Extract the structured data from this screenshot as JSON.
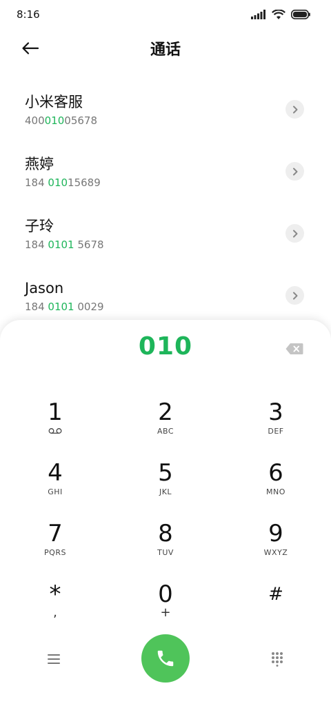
{
  "status_bar": {
    "time": "8:16"
  },
  "header": {
    "title": "通话"
  },
  "contacts": [
    {
      "name": "小米客服",
      "number_pre": "400",
      "number_hl": "010",
      "number_post": "05678"
    },
    {
      "name": "燕婷",
      "number_pre": "184 ",
      "number_hl": "010",
      "number_post": "15689"
    },
    {
      "name": "子玲",
      "number_pre": "184 ",
      "number_hl": "0101",
      "number_post": " 5678"
    },
    {
      "name": "Jason",
      "number_pre": "184 ",
      "number_hl": "0101",
      "number_post": " 0029"
    }
  ],
  "dialer": {
    "input": "010",
    "keys": [
      {
        "digit": "1",
        "letters": ""
      },
      {
        "digit": "2",
        "letters": "ABC"
      },
      {
        "digit": "3",
        "letters": "DEF"
      },
      {
        "digit": "4",
        "letters": "GHI"
      },
      {
        "digit": "5",
        "letters": "JKL"
      },
      {
        "digit": "6",
        "letters": "MNO"
      },
      {
        "digit": "7",
        "letters": "PQRS"
      },
      {
        "digit": "8",
        "letters": "TUV"
      },
      {
        "digit": "9",
        "letters": "WXYZ"
      },
      {
        "digit": "*",
        "letters": ","
      },
      {
        "digit": "0",
        "letters": "+"
      },
      {
        "digit": "#",
        "letters": ""
      }
    ]
  },
  "colors": {
    "accent": "#1eb55a",
    "call": "#4fc45a"
  }
}
